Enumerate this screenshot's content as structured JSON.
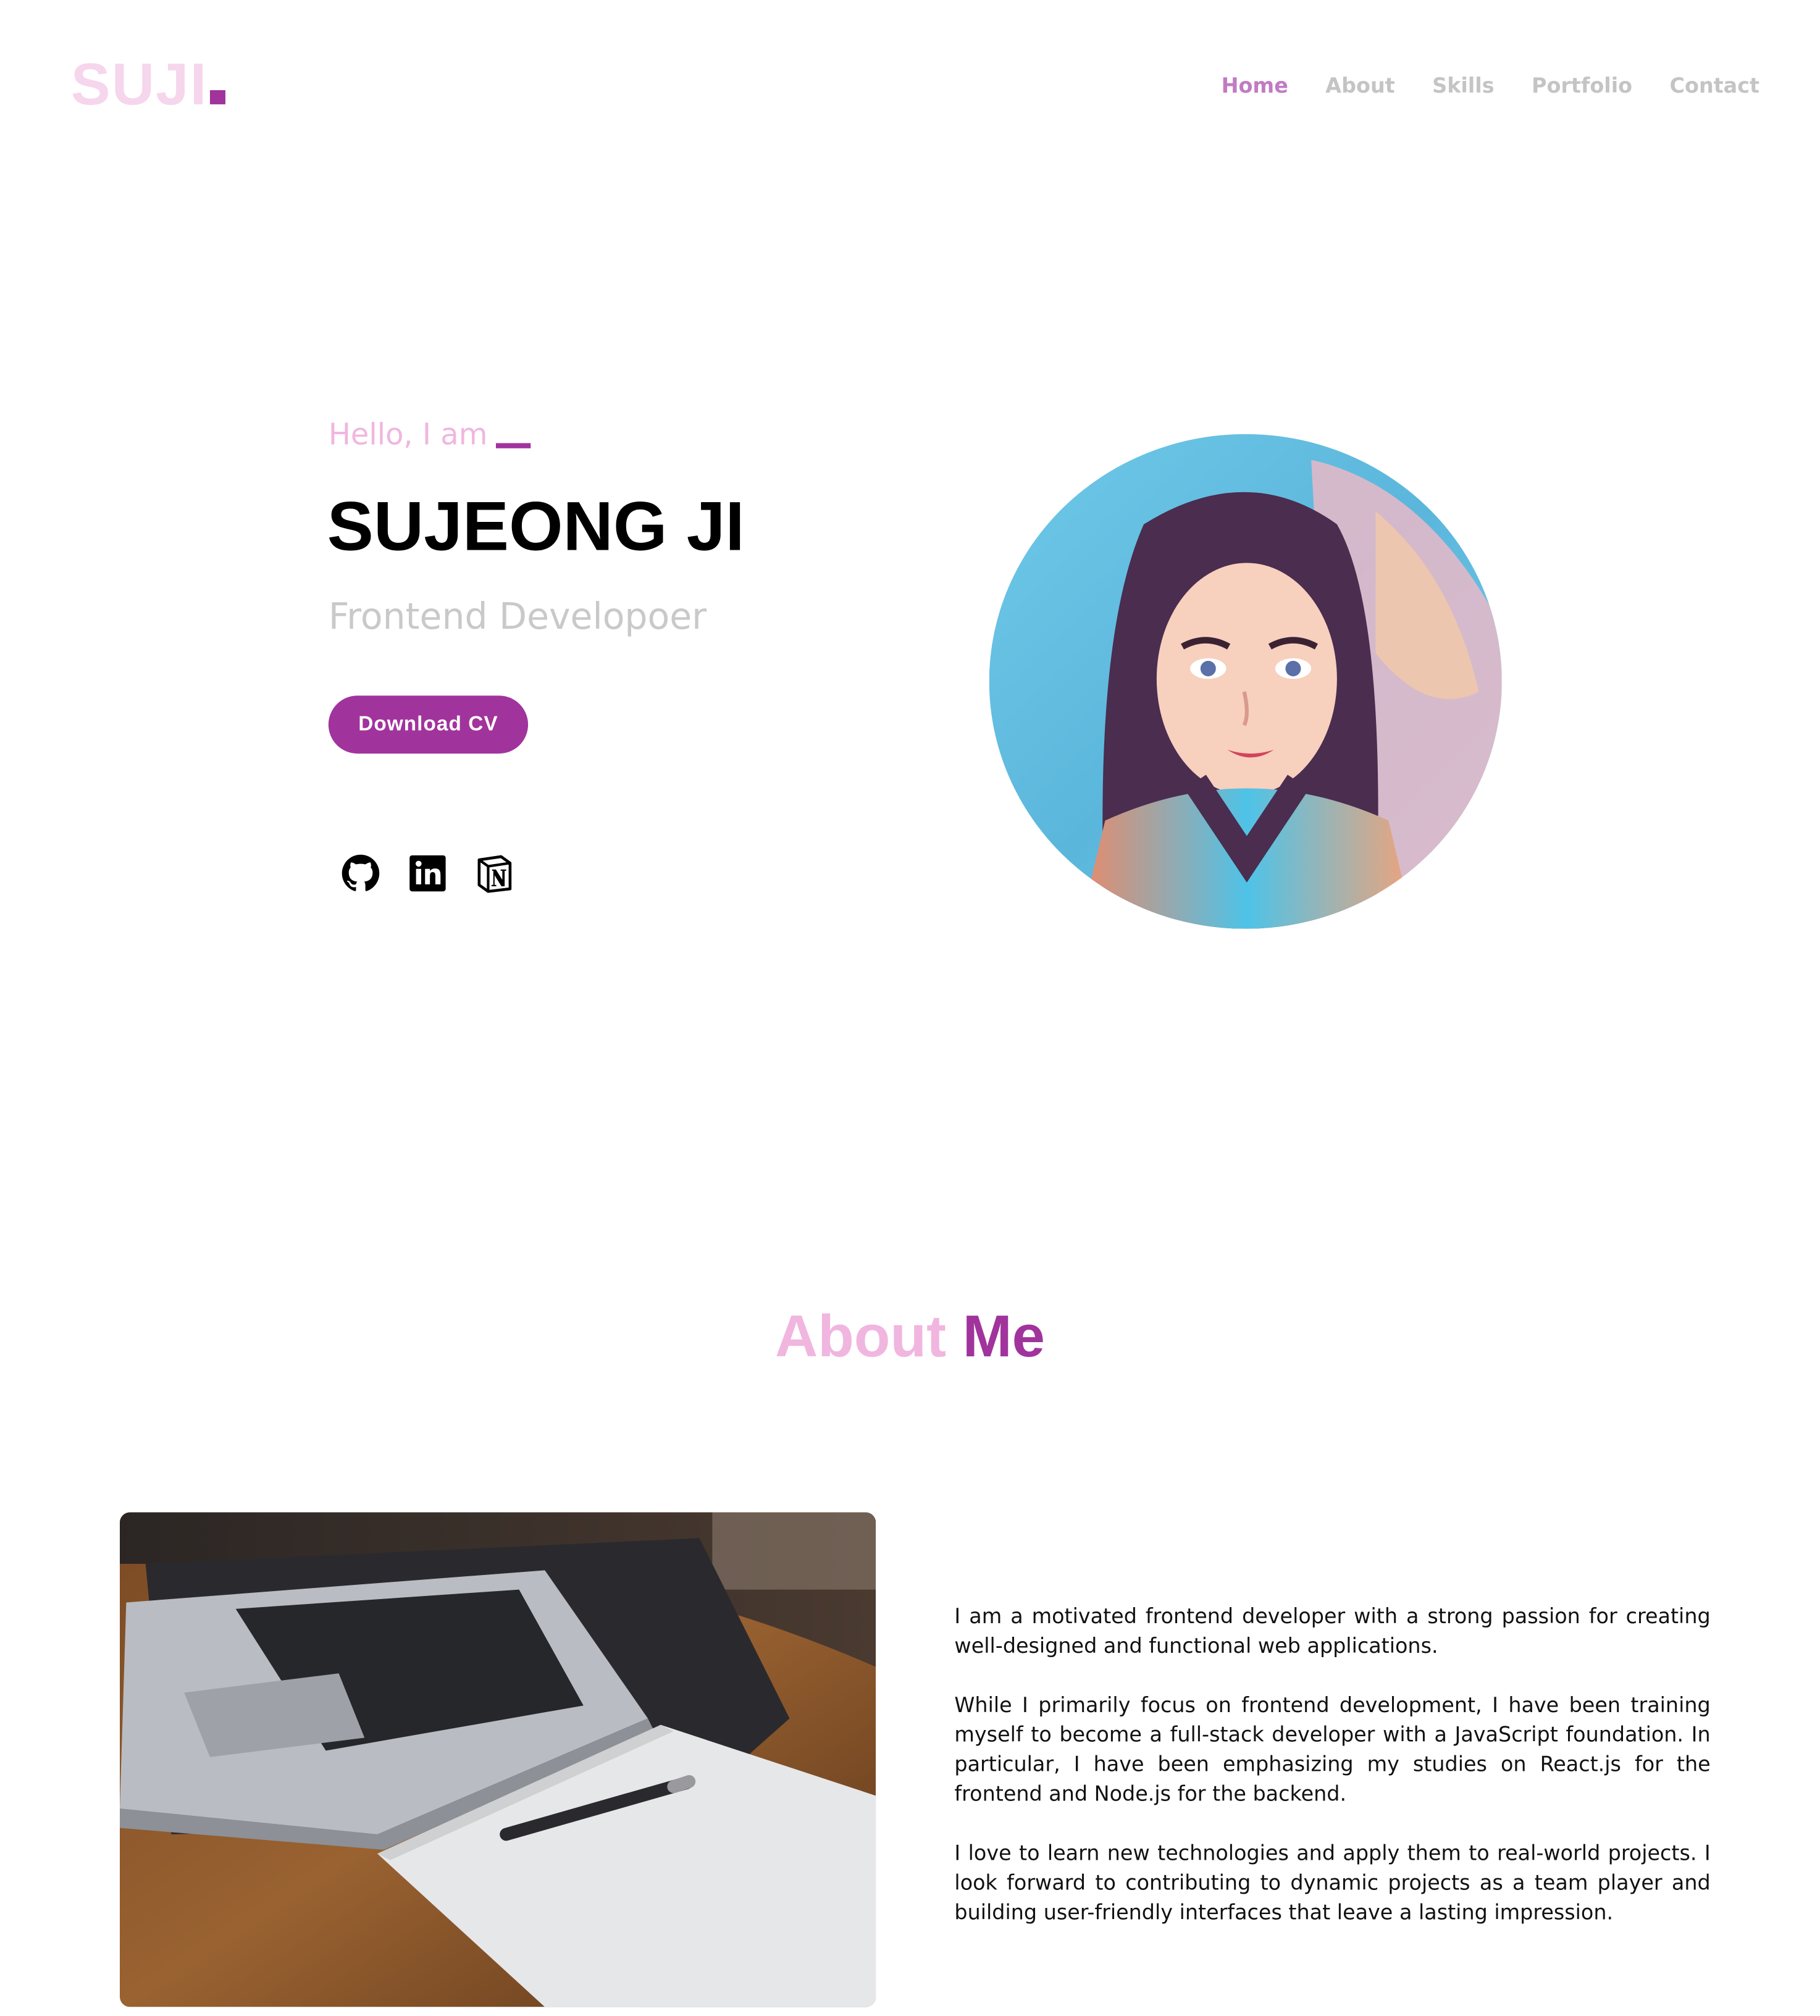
{
  "header": {
    "logo_text": "SUJI",
    "nav": [
      "Home",
      "About",
      "Skills",
      "Portfolio",
      "Contact"
    ],
    "active_nav": "Home"
  },
  "hero": {
    "greeting": "Hello, I am",
    "name": "SUJEONG JI",
    "role": "Frontend Developoer",
    "cta_label": "Download CV",
    "social_icons": [
      "github-icon",
      "linkedin-icon",
      "notion-icon"
    ]
  },
  "about": {
    "title_part1": "About",
    "title_part2": "Me",
    "paragraphs": [
      "I am a motivated frontend developer with a strong passion for creating well-designed and functional web applications.",
      "While I primarily focus on frontend development, I have been training myself to become a full-stack developer with a JavaScript foundation. In particular, I have been emphasizing my studies on React.js for the frontend and Node.js for the backend.",
      "I love to learn new technologies and apply them to real-world projects. I look forward to contributing to dynamic projects as a team player and building user-friendly interfaces that leave a lasting impression."
    ]
  },
  "colors": {
    "accent": "#a1339d",
    "accent_light": "#f0b6df",
    "logo_light": "#f6d6ec",
    "nav_inactive": "#c4c4c4",
    "nav_active": "#c07bc4",
    "role_gray": "#c9c9c9"
  }
}
